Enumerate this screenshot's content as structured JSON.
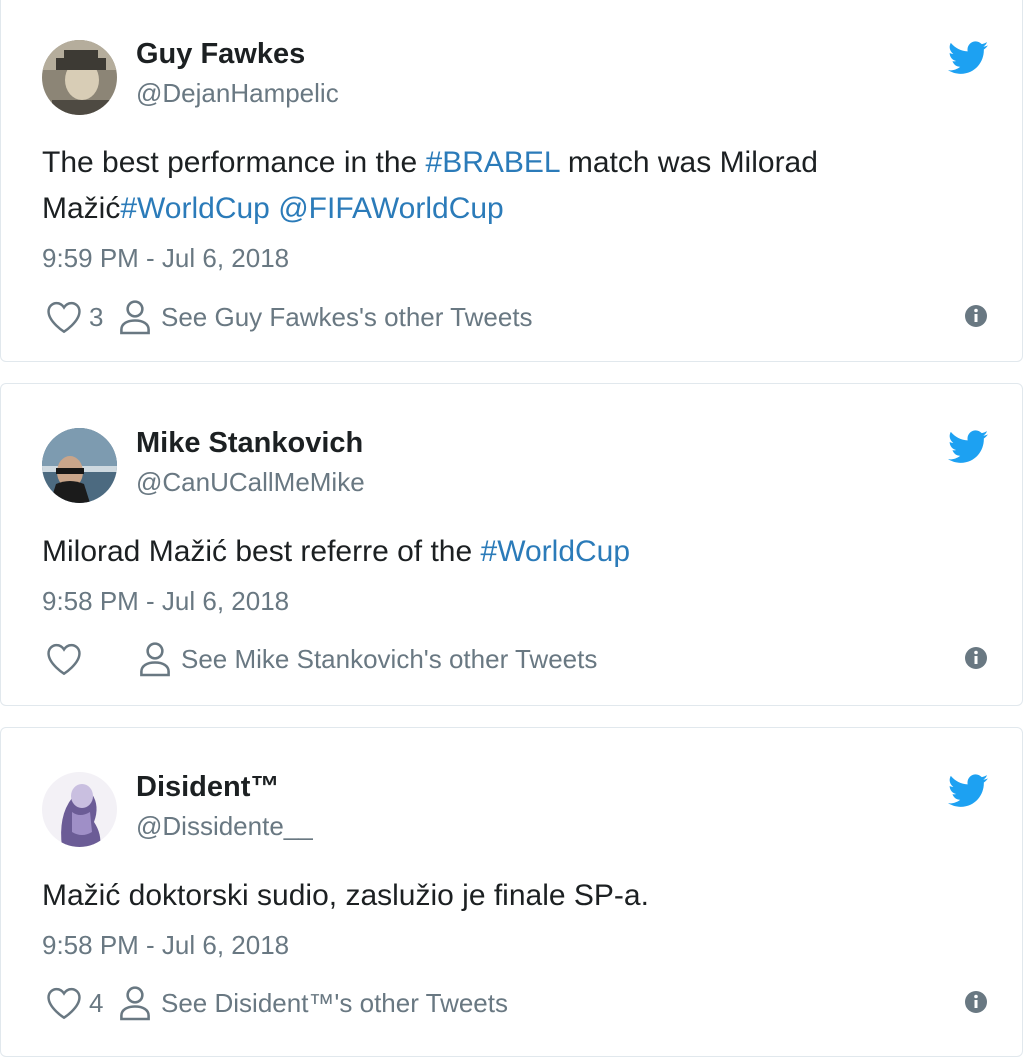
{
  "tweets": [
    {
      "name": "Guy Fawkes",
      "handle": "@DejanHampelic",
      "text_segments": [
        {
          "text": "The best performance in the ",
          "link": false
        },
        {
          "text": "#BRABEL",
          "link": true
        },
        {
          "text": " match was Milorad Mažić",
          "link": false
        },
        {
          "text": "#WorldCup",
          "link": true
        },
        {
          "text": " ",
          "link": false
        },
        {
          "text": "@FIFAWorldCup",
          "link": true
        }
      ],
      "timestamp": "9:59 PM - Jul 6, 2018",
      "likes": "3",
      "other_tweets_label": "See Guy Fawkes's other Tweets",
      "avatar_icon": "avatar-guy-fawkes"
    },
    {
      "name": "Mike Stankovich",
      "handle": "@CanUCallMeMike",
      "text_segments": [
        {
          "text": "Milorad Mažić best referre of the ",
          "link": false
        },
        {
          "text": "#WorldCup",
          "link": true
        }
      ],
      "timestamp": "9:58 PM - Jul 6, 2018",
      "likes": "",
      "other_tweets_label": "See Mike Stankovich's other Tweets",
      "avatar_icon": "avatar-mike-stankovich"
    },
    {
      "name": "Disident™",
      "handle": "@Dissidente__",
      "text_segments": [
        {
          "text": "Mažić doktorski sudio, zaslužio je finale SP-a.",
          "link": false
        }
      ],
      "timestamp": "9:58 PM - Jul 6, 2018",
      "likes": "4",
      "other_tweets_label": "See Disident™'s other Tweets",
      "avatar_icon": "avatar-disident"
    }
  ],
  "icons": {
    "brand": "twitter-bird-icon",
    "like": "heart-icon",
    "profile": "person-icon",
    "info": "info-icon"
  },
  "colors": {
    "link": "#2b7bb9",
    "bird": "#1da1f2",
    "meta": "#697882",
    "text": "#1c2022",
    "border": "#e1e8ed"
  }
}
